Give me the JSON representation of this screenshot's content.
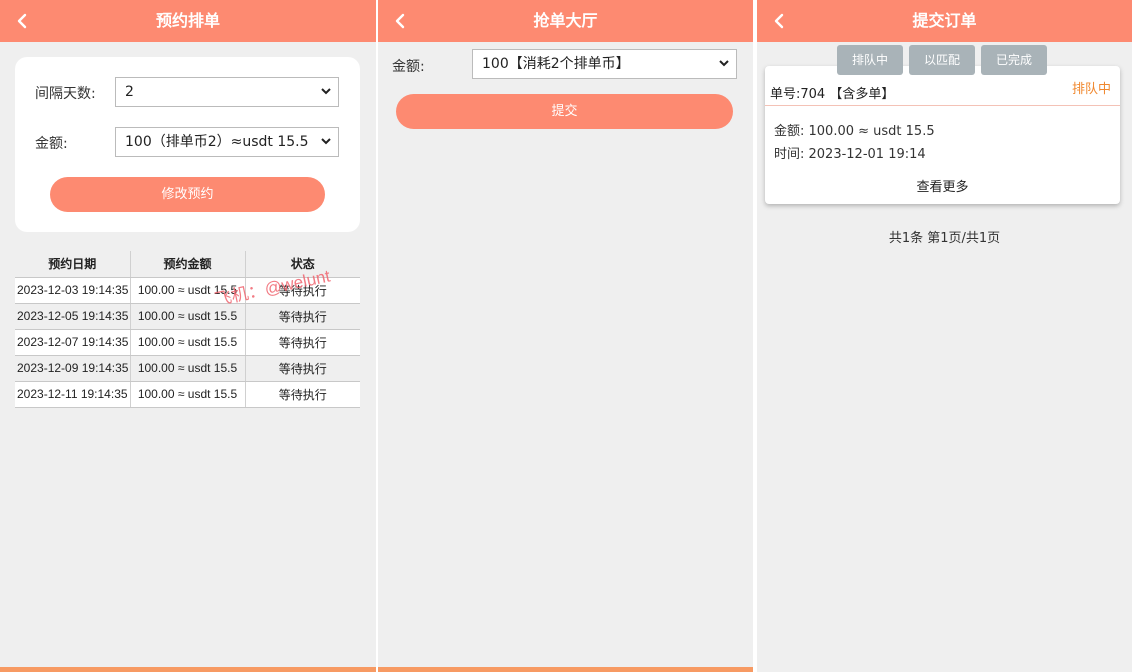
{
  "panel1": {
    "title": "预约排单",
    "interval_label": "间隔天数:",
    "interval_value": "2",
    "amount_label": "金额:",
    "amount_value": "100（排单币2）≈usdt 15.5",
    "modify_button": "修改预约",
    "table": {
      "headers": [
        "预约日期",
        "预约金额",
        "状态"
      ],
      "rows": [
        {
          "date": "2023-12-03 19:14:35",
          "amount": "100.00 ≈ usdt 15.5",
          "status": "等待执行"
        },
        {
          "date": "2023-12-05 19:14:35",
          "amount": "100.00 ≈ usdt 15.5",
          "status": "等待执行"
        },
        {
          "date": "2023-12-07 19:14:35",
          "amount": "100.00 ≈ usdt 15.5",
          "status": "等待执行"
        },
        {
          "date": "2023-12-09 19:14:35",
          "amount": "100.00 ≈ usdt 15.5",
          "status": "等待执行"
        },
        {
          "date": "2023-12-11 19:14:35",
          "amount": "100.00 ≈ usdt 15.5",
          "status": "等待执行"
        }
      ]
    },
    "watermark": "飞机：@welunt"
  },
  "panel2": {
    "title": "抢单大厅",
    "amount_label": "金额:",
    "amount_value": "100【消耗2个排单币】",
    "submit_button": "提交"
  },
  "panel3": {
    "title": "提交订单",
    "tabs": [
      "排队中",
      "以匹配",
      "已完成"
    ],
    "order": {
      "number": "单号:704 【含多单】",
      "status": "排队中",
      "amount": "金额:  100.00 ≈ usdt 15.5",
      "time": "时间:  2023-12-01 19:14",
      "more": "查看更多"
    },
    "pager": "共1条 第1页/共1页"
  },
  "colors": {
    "accent": "#fd8a71",
    "status_orange": "#f0882e",
    "tab_gray": "#a9b3b8",
    "background": "#efefef"
  },
  "icons": {
    "back": "chevron-left-icon",
    "dropdown": "chevron-down-icon"
  }
}
